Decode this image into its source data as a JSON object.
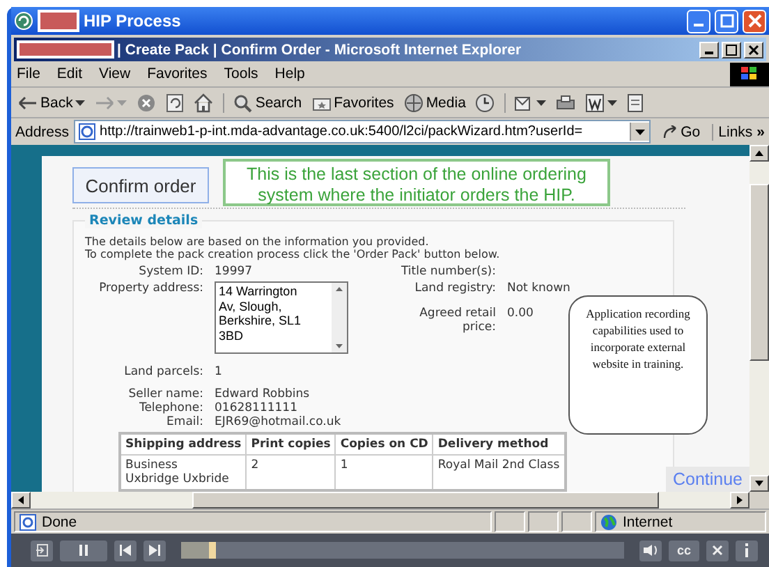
{
  "outer_window": {
    "title": "HIP Process"
  },
  "browser": {
    "title": "| Create Pack | Confirm Order - Microsoft Internet Explorer",
    "menu": [
      "File",
      "Edit",
      "View",
      "Favorites",
      "Tools",
      "Help"
    ],
    "toolbar": [
      {
        "kind": "back",
        "label": "Back"
      },
      {
        "kind": "forward"
      },
      {
        "kind": "stop"
      },
      {
        "kind": "refresh"
      },
      {
        "kind": "home"
      },
      {
        "kind": "search",
        "label": "Search"
      },
      {
        "kind": "favorites",
        "label": "Favorites"
      },
      {
        "kind": "media",
        "label": "Media"
      },
      {
        "kind": "history"
      },
      {
        "kind": "mail"
      },
      {
        "kind": "print"
      },
      {
        "kind": "word"
      },
      {
        "kind": "discuss"
      }
    ],
    "address": {
      "label": "Address",
      "value": "http://trainweb1-p-int.mda-advantage.co.uk:5400/l2ci/packWizard.htm?userId=",
      "go": "Go",
      "links": "Links",
      "more": "»"
    }
  },
  "page": {
    "confirm_button": "Confirm order",
    "callout": "This is the last section of the online ordering system where the initiator orders the HIP.",
    "section_title": "Review details",
    "intro": [
      "The details below are based on the information you provided.",
      "To complete the pack creation process click the 'Order Pack' button below."
    ],
    "system_id": {
      "label": "System ID:",
      "value": "19997"
    },
    "property_address": {
      "label": "Property address:",
      "lines": [
        "14 Warrington",
        "Av, Slough,",
        "Berkshire, SL1",
        "3BD"
      ]
    },
    "land_parcels": {
      "label": "Land parcels:",
      "value": "1"
    },
    "right_fields": [
      {
        "label": "Title number(s):"
      },
      {
        "label": "Land registry:",
        "value": "Not known"
      },
      {
        "label": "Agreed retail price:",
        "value": "0.00"
      }
    ],
    "seller_fields": [
      {
        "label": "Seller name:",
        "value": "Edward  Robbins"
      },
      {
        "label": "Telephone:",
        "value": "01628111111"
      },
      {
        "label": "Email:",
        "value": "EJR69@hotmail.co.uk"
      }
    ],
    "table": {
      "columns": [
        "Shipping address",
        "Print copies",
        "Copies on CD",
        "Delivery method"
      ],
      "rows": [
        [
          [
            "Business",
            "Uxbridge Uxbride"
          ],
          [
            "2"
          ],
          [
            "1"
          ],
          [
            "Royal Mail 2nd Class"
          ]
        ]
      ]
    },
    "note": "Application recording capabilities used to incorporate external website in training.",
    "continue_button": "Continue"
  },
  "status_bar": {
    "text": "Done",
    "zone": "Internet"
  },
  "player": {
    "level": 0.08,
    "cc": "cc"
  }
}
